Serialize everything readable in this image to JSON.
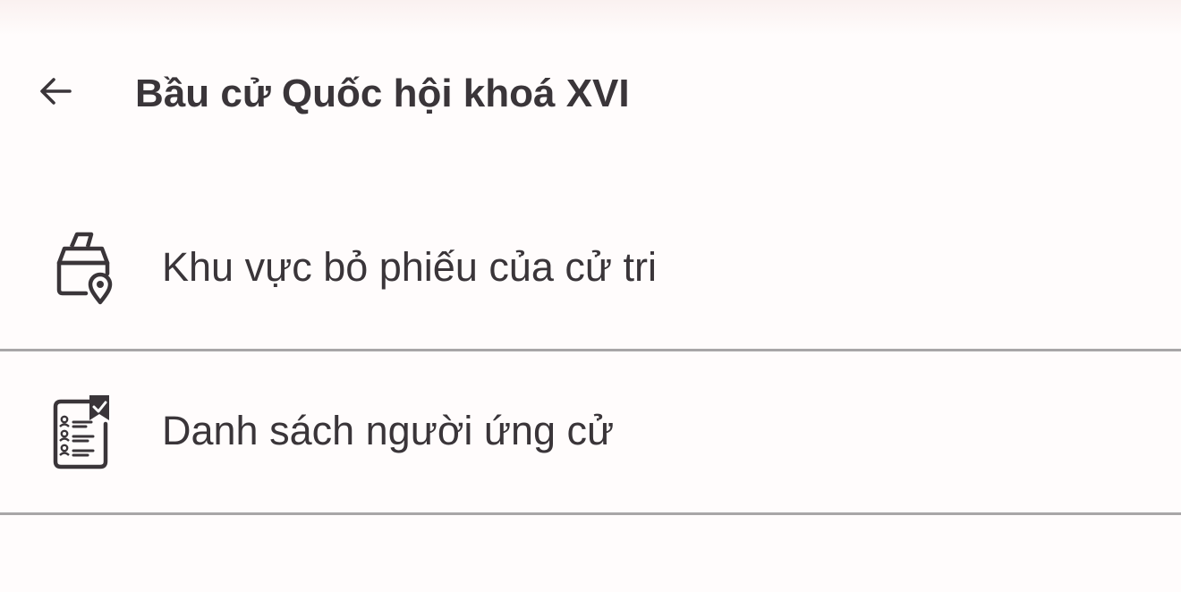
{
  "header": {
    "back_icon": "arrow-left-icon",
    "title": "Bầu cử Quốc hội khoá XVI"
  },
  "menu": {
    "items": [
      {
        "icon": "ballot-box-location-icon",
        "label": "Khu vực bỏ phiếu của cử tri"
      },
      {
        "icon": "candidate-list-icon",
        "label": "Danh sách người ứng cử"
      }
    ]
  },
  "colors": {
    "text": "#3a3539",
    "divider": "#a8a6a7",
    "background": "#fffcfc"
  }
}
